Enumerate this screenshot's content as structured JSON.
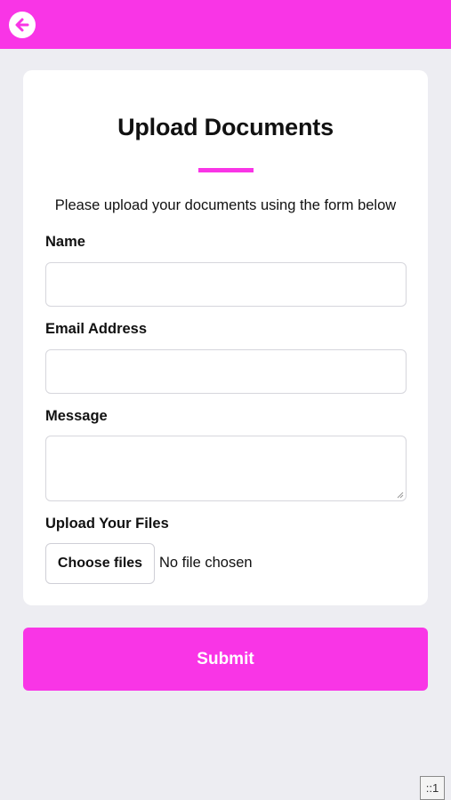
{
  "header": {
    "back_icon": "arrow-left-circle-icon",
    "accent_color": "#f935e6"
  },
  "form": {
    "title": "Upload Documents",
    "intro": "Please upload your documents using the form below",
    "name_label": "Name",
    "name_value": "",
    "email_label": "Email Address",
    "email_value": "",
    "message_label": "Message",
    "message_value": "",
    "files_label": "Upload Your Files",
    "choose_files_label": "Choose files",
    "file_status": "No file chosen"
  },
  "submit_label": "Submit",
  "corner_badge": "::1"
}
